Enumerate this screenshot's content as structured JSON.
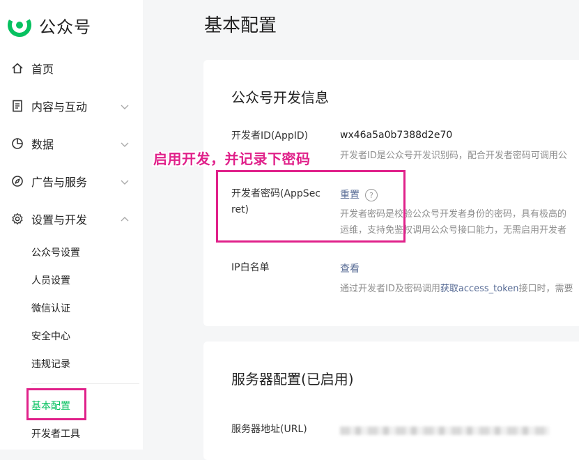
{
  "app": {
    "name": "公众号"
  },
  "colors": {
    "brand_green": "#07c160",
    "link_blue": "#576b95",
    "annotation_pink": "#e0218a"
  },
  "sidebar": {
    "items": [
      {
        "label": "首页",
        "icon": "home-icon"
      },
      {
        "label": "内容与互动",
        "icon": "document-icon"
      },
      {
        "label": "数据",
        "icon": "pie-chart-icon"
      },
      {
        "label": "广告与服务",
        "icon": "compass-icon"
      },
      {
        "label": "设置与开发",
        "icon": "gear-icon"
      }
    ],
    "sub_items": [
      {
        "label": "公众号设置"
      },
      {
        "label": "人员设置"
      },
      {
        "label": "微信认证"
      },
      {
        "label": "安全中心"
      },
      {
        "label": "违规记录"
      },
      {
        "label": "基本配置"
      },
      {
        "label": "开发者工具"
      }
    ]
  },
  "page": {
    "title": "基本配置"
  },
  "dev_info": {
    "title": "公众号开发信息",
    "appid_label": "开发者ID(AppID)",
    "appid_value": "wx46a5a0b7388d2e70",
    "appid_desc": "开发者ID是公众号开发识别码，配合开发者密码可调用公",
    "secret_label_1": "开发者密码(AppSec",
    "secret_label_2": "ret)",
    "secret_action": "重置",
    "secret_help": "?",
    "secret_desc_1": "开发者密码是校验公众号开发者身份的密码，具有极高的",
    "secret_desc_2": "运维，支持免鉴权调用公众号接口能力，无需启用开发者",
    "ip_label": "IP白名单",
    "ip_action": "查看",
    "ip_desc_pre": "通过开发者ID及密码调用",
    "ip_desc_link": "获取access_token",
    "ip_desc_post": "接口时，需要"
  },
  "server_config": {
    "title": "服务器配置(已启用)",
    "url_label": "服务器地址(URL)"
  },
  "annotation": {
    "text": "启用开发，并记录下密码"
  }
}
